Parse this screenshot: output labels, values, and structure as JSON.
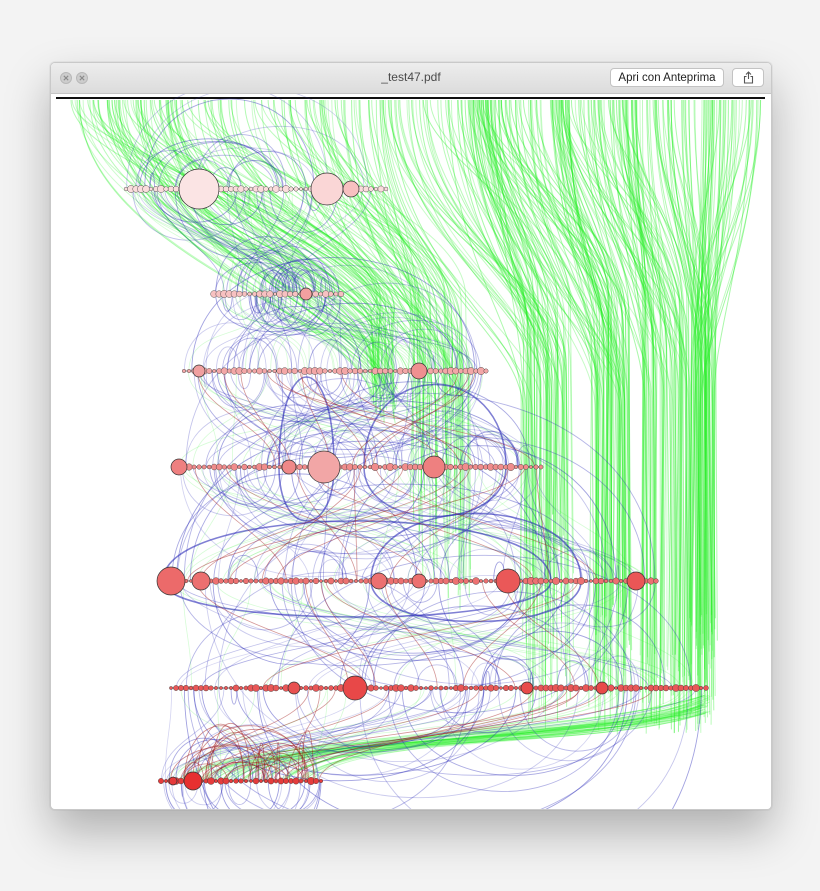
{
  "window": {
    "title": "_test47.pdf",
    "open_button_label": "Apri con Anteprima",
    "share_button_icon": "share-icon"
  },
  "traffic_lights": [
    "close-icon",
    "minimize-icon"
  ],
  "document": {
    "content": "hierarchical network diagram",
    "edge_colors": {
      "green": "#22ee22",
      "blue": "#2a2ab8",
      "red": "#a01818"
    },
    "node_fill_range": [
      "#fbe2e2",
      "#ea3a3a"
    ],
    "layer_count": 7
  }
}
